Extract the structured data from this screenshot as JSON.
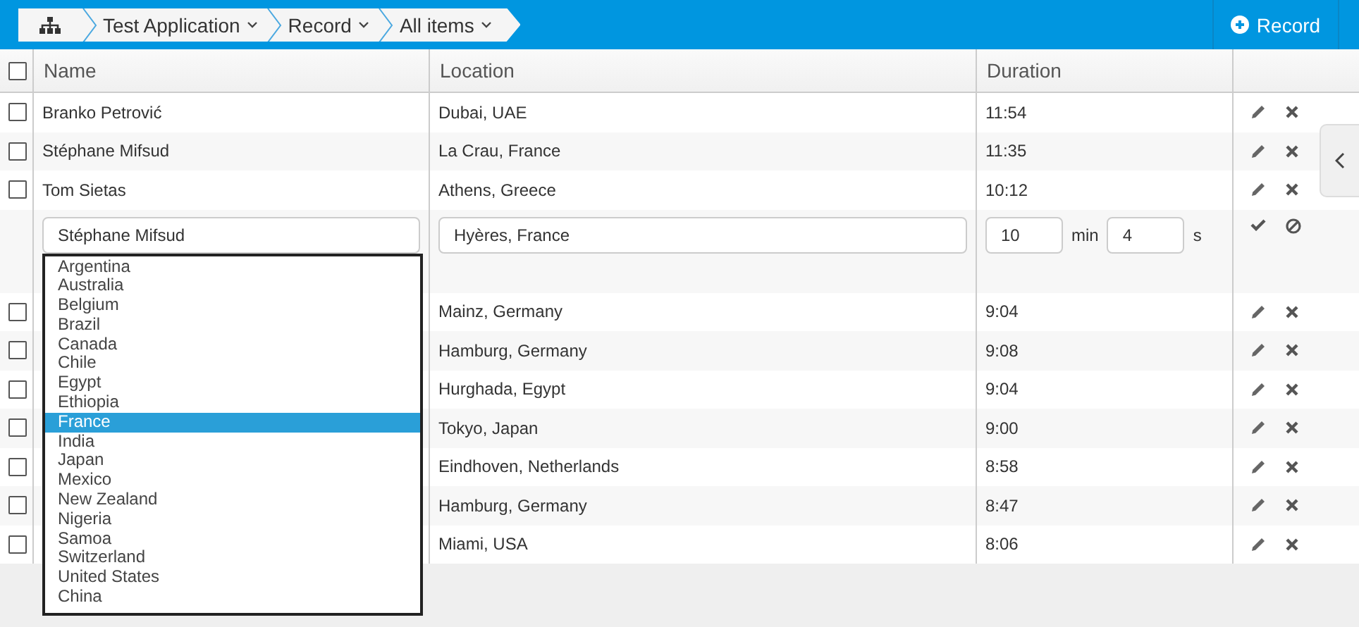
{
  "breadcrumb": [
    {
      "label": "Test Application",
      "dropdown": true
    },
    {
      "label": "Record",
      "dropdown": true
    },
    {
      "label": "All items",
      "dropdown": true
    }
  ],
  "add_button": {
    "label": "Record"
  },
  "table": {
    "select_all": {
      "checked": false
    },
    "columns": [
      "Name",
      "Location",
      "Duration"
    ],
    "rows": [
      {
        "kind": "view",
        "checked": false,
        "name": "Branko Petrović",
        "location": "Dubai, UAE",
        "duration": "11:54"
      },
      {
        "kind": "view",
        "checked": false,
        "name": "Stéphane Mifsud",
        "location": "La Crau, France",
        "duration": "11:35"
      },
      {
        "kind": "view",
        "checked": false,
        "name": "Tom Sietas",
        "location": "Athens, Greece",
        "duration": "10:12"
      },
      {
        "kind": "edit",
        "name": "Stéphane Mifsud",
        "location": "Hyères, France",
        "minutes": "10",
        "minutes_unit": "min",
        "seconds": "4",
        "seconds_unit": "s"
      },
      {
        "kind": "view",
        "checked": false,
        "location": "Mainz, Germany",
        "duration": "9:04"
      },
      {
        "kind": "view",
        "checked": false,
        "location": "Hamburg, Germany",
        "duration": "9:08"
      },
      {
        "kind": "view",
        "checked": false,
        "location": "Hurghada, Egypt",
        "duration": "9:04"
      },
      {
        "kind": "view",
        "checked": false,
        "location": "Tokyo, Japan",
        "duration": "9:00"
      },
      {
        "kind": "view",
        "checked": false,
        "location": "Eindhoven, Netherlands",
        "duration": "8:58"
      },
      {
        "kind": "view",
        "checked": false,
        "location": "Hamburg, Germany",
        "duration": "8:47"
      },
      {
        "kind": "view",
        "checked": false,
        "location": "Miami, USA",
        "duration": "8:06"
      }
    ]
  },
  "country_list": [
    {
      "label": "Argentina",
      "selected": false
    },
    {
      "label": "Australia",
      "selected": false
    },
    {
      "label": "Belgium",
      "selected": false
    },
    {
      "label": "Brazil",
      "selected": false
    },
    {
      "label": "Canada",
      "selected": false
    },
    {
      "label": "Chile",
      "selected": false
    },
    {
      "label": "Egypt",
      "selected": false
    },
    {
      "label": "Ethiopia",
      "selected": false
    },
    {
      "label": "France",
      "selected": true
    },
    {
      "label": "India",
      "selected": false
    },
    {
      "label": "Japan",
      "selected": false
    },
    {
      "label": "Mexico",
      "selected": false
    },
    {
      "label": "New Zealand",
      "selected": false
    },
    {
      "label": "Nigeria",
      "selected": false
    },
    {
      "label": "Samoa",
      "selected": false
    },
    {
      "label": "Switzerland",
      "selected": false
    },
    {
      "label": "United States",
      "selected": false
    },
    {
      "label": "China",
      "selected": false
    }
  ]
}
